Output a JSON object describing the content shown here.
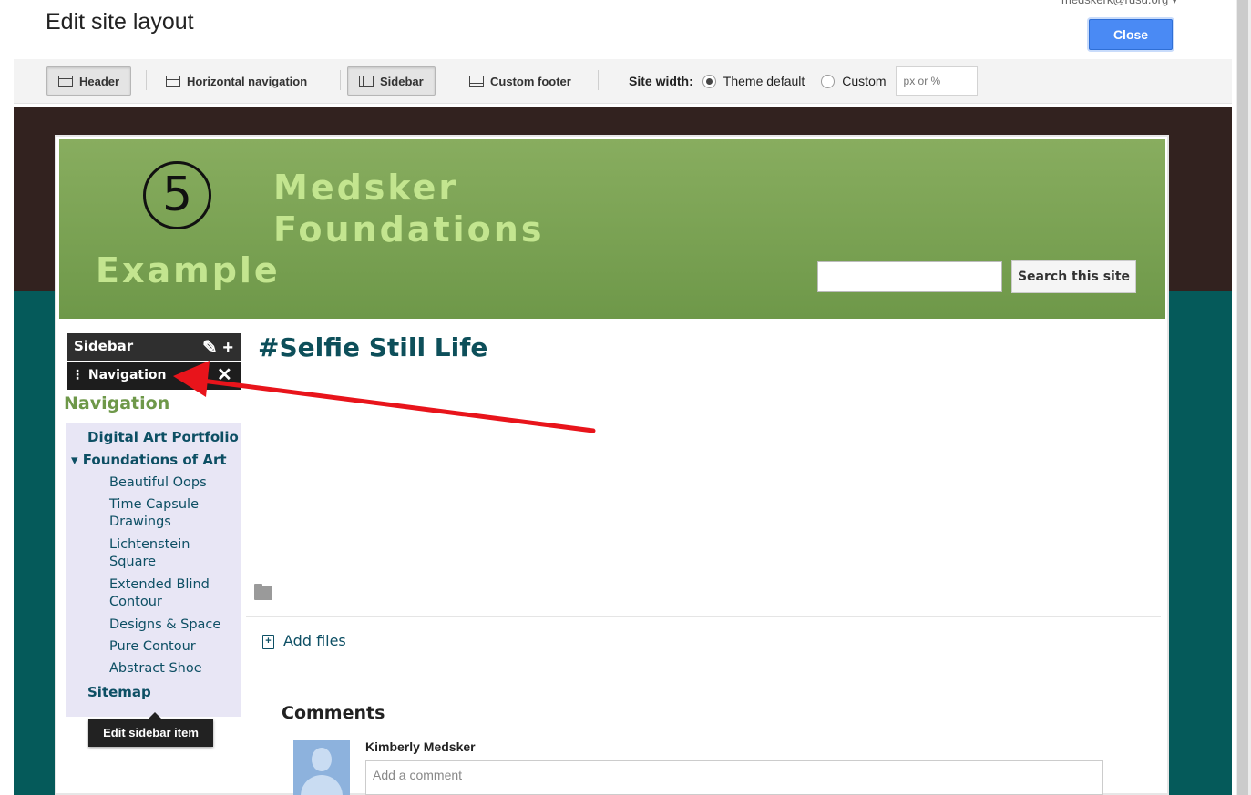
{
  "top_bar": {
    "title": "Edit site layout",
    "account": "medskerk@rusd.org ▾",
    "close_label": "Close"
  },
  "toolbar": {
    "header_label": "Header",
    "horizontal_nav_label": "Horizontal navigation",
    "sidebar_label": "Sidebar",
    "custom_footer_label": "Custom footer",
    "site_width_label": "Site width:",
    "theme_default_label": "Theme default",
    "custom_label": "Custom",
    "width_placeholder": "px or %",
    "selected_width_option": "Theme default"
  },
  "site": {
    "title_line1": "Medsker",
    "title_line2": "Foundations",
    "annotation_number": "5",
    "example_label": "Example",
    "search_button": "Search this site"
  },
  "sidebar": {
    "header_label": "Sidebar",
    "header_tools": "✎ +",
    "nav_gadget_label": "⋮ Navigation",
    "close_glyph": "✕",
    "nav_heading": "Navigation",
    "items": [
      {
        "label": "Digital Art Portfolio",
        "level": 0
      },
      {
        "label": "▾ Foundations of Art",
        "level": 0
      },
      {
        "label": "Beautiful Oops",
        "level": 1
      },
      {
        "label": "Time Capsule Drawings",
        "level": 1
      },
      {
        "label": "Lichtenstein Square",
        "level": 1
      },
      {
        "label": "Extended Blind Contour",
        "level": 1
      },
      {
        "label": "Designs & Space",
        "level": 1
      },
      {
        "label": "Pure Contour",
        "level": 1
      },
      {
        "label": "Abstract Shoe",
        "level": 1
      },
      {
        "label": "Sitemap",
        "level": 0
      }
    ],
    "tooltip": "Edit sidebar item"
  },
  "main": {
    "page_title": "#Selfie Still Life",
    "add_files_label": "Add files",
    "comments_heading": "Comments",
    "commenter_name": "Kimberly Medsker",
    "comment_placeholder": "Add a comment"
  },
  "colors": {
    "header_green": "#7aa152",
    "title_green": "#c3e58f",
    "dark_band": "#32221f",
    "teal_band": "#055a5a",
    "link_color": "#0d4f64",
    "close_blue": "#4a8af4",
    "annotation_arrow": "#e8141b"
  }
}
